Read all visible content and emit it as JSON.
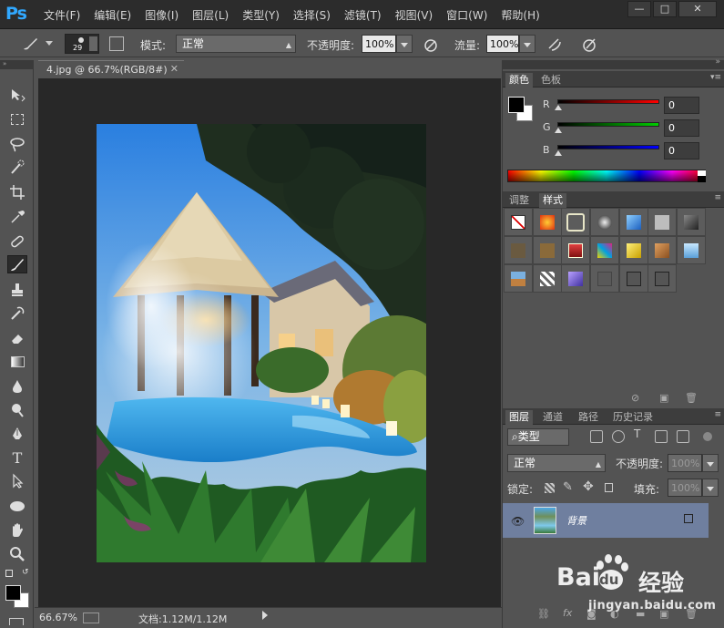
{
  "app": {
    "logo": "Ps",
    "menu": [
      "文件(F)",
      "编辑(E)",
      "图像(I)",
      "图层(L)",
      "类型(Y)",
      "选择(S)",
      "滤镜(T)",
      "视图(V)",
      "窗口(W)",
      "帮助(H)"
    ],
    "window_buttons": [
      "minimize-icon",
      "maximize-icon",
      "close-icon"
    ]
  },
  "options": {
    "brush_size": "29",
    "mode_label": "模式:",
    "mode_value": "正常",
    "opacity_label": "不透明度:",
    "opacity_value": "100%",
    "flow_label": "流量:",
    "flow_value": "100%"
  },
  "toolbox": {
    "tools": [
      "move-icon",
      "marquee-icon",
      "lasso-icon",
      "quick-selection-icon",
      "crop-icon",
      "eyedropper-icon",
      "healing-brush-icon",
      "brush-icon",
      "clone-stamp-icon",
      "history-brush-icon",
      "eraser-icon",
      "gradient-icon",
      "blur-icon",
      "dodge-icon",
      "pen-icon",
      "type-icon",
      "path-selection-icon",
      "ellipse-icon",
      "hand-icon",
      "zoom-icon"
    ],
    "active_tool": "brush-icon",
    "type_tool_glyph": "T",
    "foreground_color": "#000000",
    "background_color": "#ffffff"
  },
  "document": {
    "tab_title": "4.jpg @ 66.7%(RGB/8#)",
    "zoom": "66.67%",
    "doc_size": "文档:1.12M/1.12M"
  },
  "color_panel": {
    "tabs": [
      "颜色",
      "色板"
    ],
    "active_tab": "颜色",
    "channels": [
      {
        "label": "R",
        "value": "0",
        "color": "#ff0000"
      },
      {
        "label": "G",
        "value": "0",
        "color": "#00c000"
      },
      {
        "label": "B",
        "value": "0",
        "color": "#0000ff"
      }
    ]
  },
  "styles_panel": {
    "tabs": [
      "调整",
      "样式"
    ],
    "active_tab": "样式"
  },
  "layers_panel": {
    "tabs": [
      "图层",
      "通道",
      "路径",
      "历史记录"
    ],
    "active_tab": "图层",
    "kind_filter": "类型",
    "blend_mode": "正常",
    "opacity_label": "不透明度:",
    "opacity_value": "100%",
    "lock_label": "锁定:",
    "fill_label": "填充:",
    "fill_value": "100%",
    "layers": [
      {
        "name": "背景",
        "visible": true,
        "locked": true
      }
    ]
  },
  "watermark": {
    "brand": "Bai",
    "brand_tail": "du",
    "brand_cn": "经验",
    "url": "jingyan.baidu.com"
  }
}
